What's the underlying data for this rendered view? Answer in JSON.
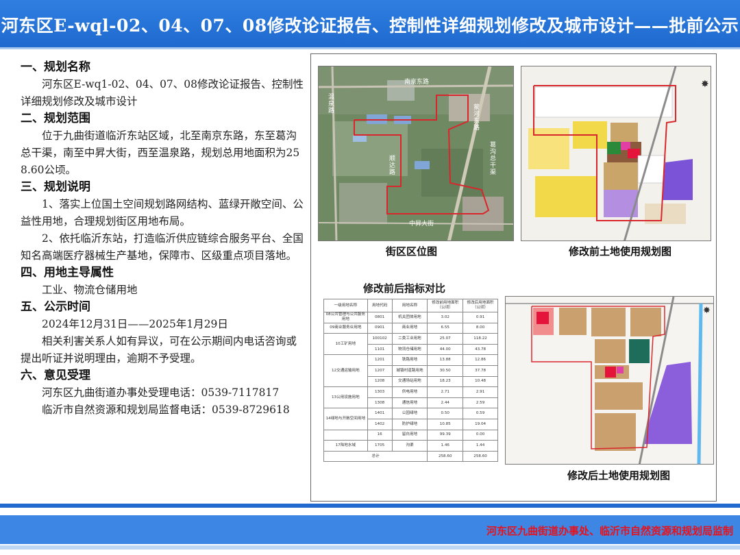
{
  "header": {
    "title": "河东区E-wql-02、04、07、08修改论证报告、控制性详细规划修改及城市设计——批前公示"
  },
  "sections": [
    {
      "heading": "一、规划名称",
      "paras": [
        "河东区E-wq1-02、04、07、08修改论证报告、控制性详细规划修改及城市设计"
      ]
    },
    {
      "heading": "二、规划范围",
      "paras": [
        "位于九曲街道临沂东站区域，北至南京东路，东至葛沟总干渠，南至中昇大街，西至温泉路，规划总用地面积为258.60公顷。"
      ]
    },
    {
      "heading": "三、规划说明",
      "paras": [
        "1、落实上位国土空间规划路网结构、蓝绿开敞空间、公益性用地，合理规划街区用地布局。",
        "2、依托临沂东站，打造临沂供应链综合服务平台、全国知名高端医疗器械生产基地，保障市、区级重点项目落地。"
      ]
    },
    {
      "heading": "四、用地主导属性",
      "paras": [
        "工业、物流仓储用地"
      ]
    },
    {
      "heading": "五、公示时间",
      "paras": [
        "2024年12月31日——2025年1月29日",
        "相关利害关系人如有异议，可在公示期间内电话咨询或提出听证并说明理由，逾期不予受理。"
      ]
    },
    {
      "heading": "六、意见受理",
      "paras": [
        "河东区九曲街道办事处受理电话：0539-7117817",
        "临沂市自然资源和规划局监督电话：0539-8729618"
      ]
    }
  ],
  "maps": {
    "location": {
      "caption": "街区区位图",
      "labels": {
        "north": "南京东路",
        "west": "温泉路",
        "east_road": "蒙河东路",
        "center": "顺达路",
        "canal": "葛沟总干渠",
        "south": "中昇大街"
      }
    },
    "before": {
      "caption": "修改前土地使用规划图"
    },
    "after": {
      "caption": "修改后土地使用规划图"
    }
  },
  "table": {
    "title": "修改前后指标对比",
    "headers": [
      "一级用地名称",
      "用地代码",
      "用地名称",
      "修改前用地面积（公顷）",
      "修改后用地面积（公顷）"
    ],
    "rows": [
      {
        "group": "08公共管理与公共服务用地",
        "code": "0801",
        "name": "机关团体用地",
        "before": "3.02",
        "after": "0.91"
      },
      {
        "group": "09商业服务业用地",
        "code": "0901",
        "name": "商业用地",
        "before": "6.55",
        "after": "8.00"
      },
      {
        "group": "10工矿用地",
        "code": "100102",
        "name": "二类工业用地",
        "before": "25.07",
        "after": "118.22"
      },
      {
        "group": "",
        "code": "1101",
        "name": "物流仓储用地",
        "before": "44.00",
        "after": "43.78"
      },
      {
        "group": "12交通运输用地",
        "code": "1201",
        "name": "铁路用地",
        "before": "13.88",
        "after": "12.86"
      },
      {
        "group": "",
        "code": "1207",
        "name": "城镇村道路用地",
        "before": "30.50",
        "after": "37.78"
      },
      {
        "group": "",
        "code": "1208",
        "name": "交通场站用地",
        "before": "18.23",
        "after": "10.48"
      },
      {
        "group": "13公用设施用地",
        "code": "1303",
        "name": "供电用地",
        "before": "2.71",
        "after": "2.91"
      },
      {
        "group": "",
        "code": "1308",
        "name": "通信用地",
        "before": "2.44",
        "after": "2.59"
      },
      {
        "group": "14绿地与开敞空间用地",
        "code": "1401",
        "name": "公园绿地",
        "before": "0.50",
        "after": "0.59"
      },
      {
        "group": "",
        "code": "1402",
        "name": "防护绿地",
        "before": "10.85",
        "after": "19.04"
      },
      {
        "group": "",
        "code": "16",
        "name": "留白用地",
        "before": "99.39",
        "after": "0.00"
      },
      {
        "group": "17陆地水域",
        "code": "1705",
        "name": "沟渠",
        "before": "1.46",
        "after": "1.44"
      }
    ],
    "total": {
      "label": "总计",
      "before": "258.60",
      "after": "258.60"
    }
  },
  "footer": {
    "text": "河东区九曲街道办事处、临沂市自然资源和规划局监制"
  },
  "colors": {
    "header_blue": "#1f69cf",
    "footer_blue": "#3d86e4",
    "footer_text_red": "#e8121b",
    "boundary_red": "#d9262c"
  }
}
